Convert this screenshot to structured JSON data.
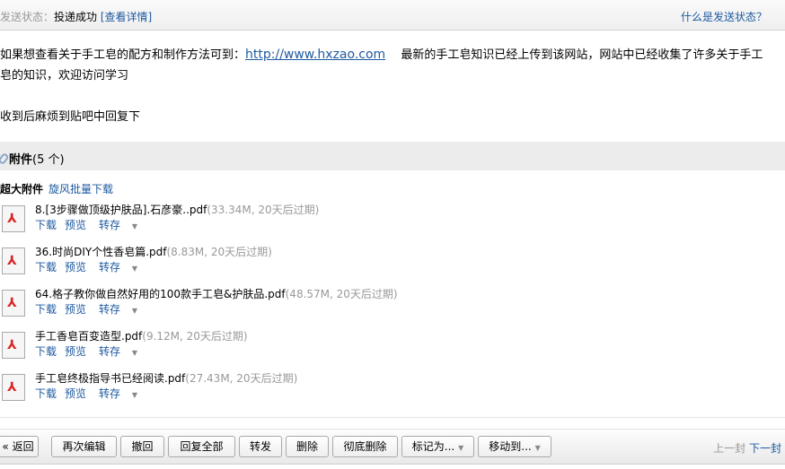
{
  "topbar": {
    "status_label": "发送状态：",
    "status_value": "投递成功",
    "detail_link": "[查看详情]",
    "help_link": "什么是发送状态？"
  },
  "body": {
    "text1": "如果想查看关于手工皂的配方和制作方法可到：",
    "url": "http://www.hxzao.com",
    "text2": "　 最新的手工皂知识已经上传到该网站，网站中已经收集了许多关于手工皂的知识，欢迎访问学习",
    "text3": "收到后麻烦到贴吧中回复下"
  },
  "attachments": {
    "title": "附件",
    "count": "(5 个)",
    "big_label": "超大附件",
    "batch_download": "旋风批量下载",
    "items": [
      {
        "name": "8.[3步骤做顶级护肤品].石彦豪..pdf",
        "meta": "(33.34M, 20天后过期)"
      },
      {
        "name": "36.时尚DIY个性香皂篇.pdf",
        "meta": "(8.83M, 20天后过期)"
      },
      {
        "name": "64.格子教你做自然好用的100款手工皂&护肤品.pdf",
        "meta": "(48.57M, 20天后过期)"
      },
      {
        "name": "手工香皂百变造型.pdf",
        "meta": "(9.12M, 20天后过期)"
      },
      {
        "name": "手工皂终极指导书已经阅读.pdf",
        "meta": "(27.43M, 20天后过期)"
      }
    ],
    "actions": {
      "download": "下载",
      "preview": "预览",
      "save": "转存"
    }
  },
  "toolbar": {
    "back": "« 返回",
    "reedit": "再次编辑",
    "recall": "撤回",
    "reply_all": "回复全部",
    "forward": "转发",
    "delete": "删除",
    "delete_perm": "彻底删除",
    "mark_as": "标记为...",
    "move_to": "移动到...",
    "prev": "上一封",
    "next": "下一封"
  }
}
